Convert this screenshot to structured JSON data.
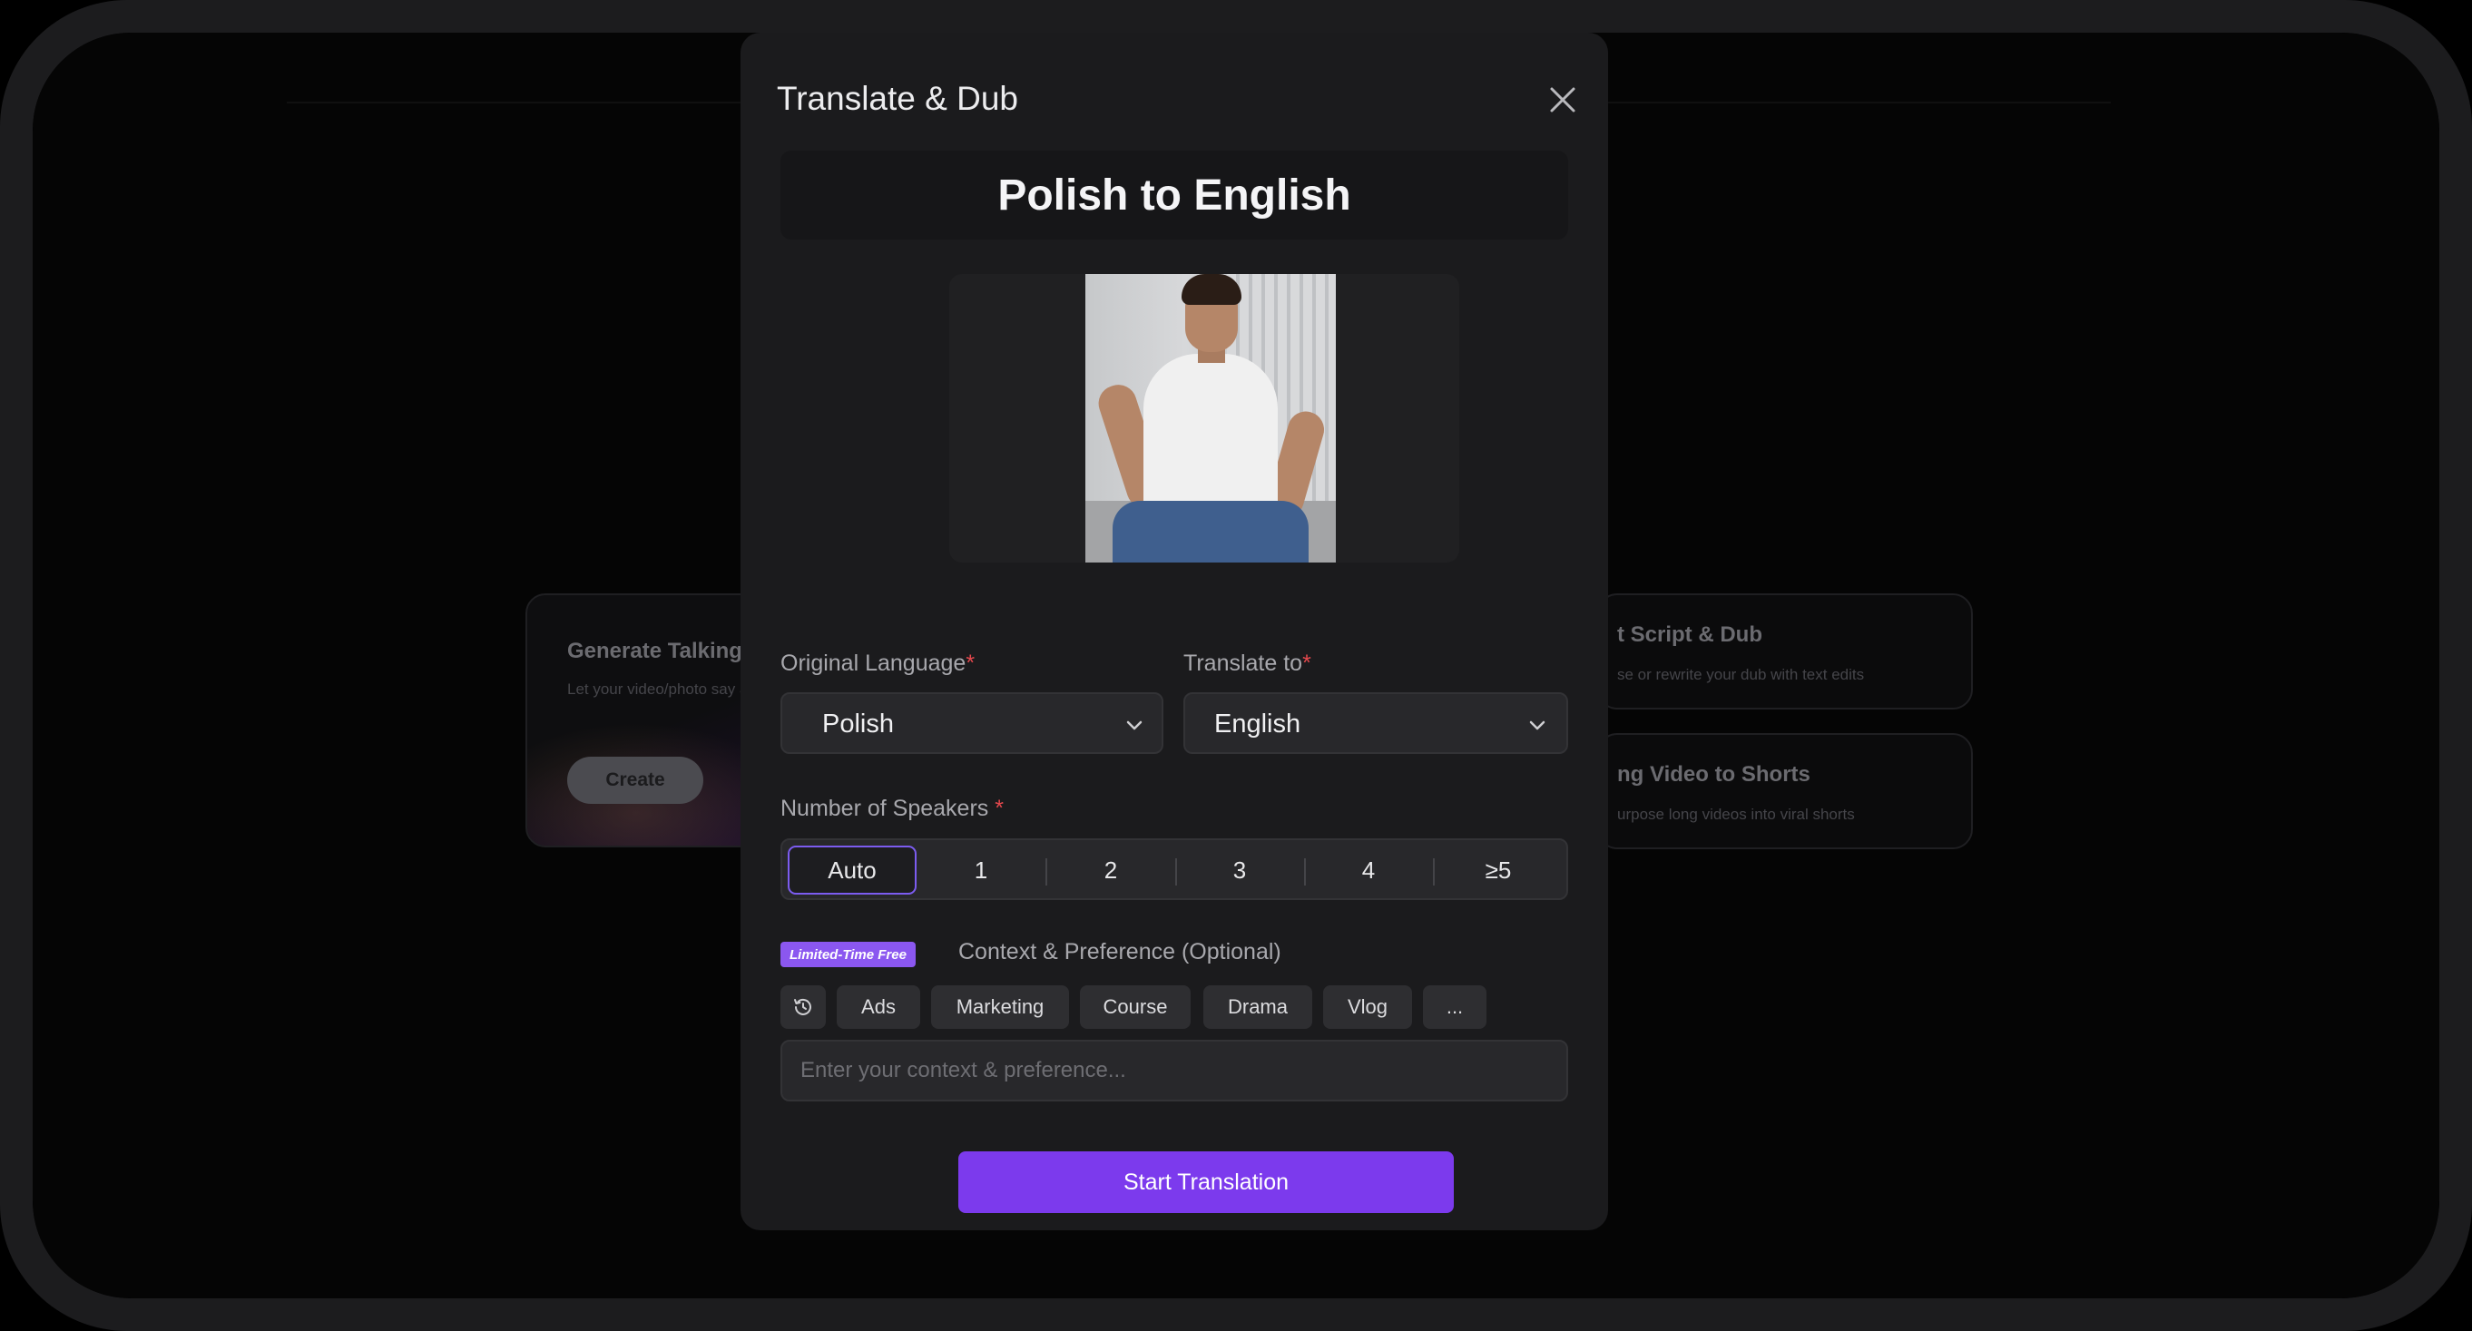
{
  "background": {
    "card_left": {
      "title": "Generate Talking Vi",
      "subtitle": "Let your video/photo say an",
      "button_label": "Create"
    },
    "card_right_1": {
      "title": "t Script & Dub",
      "subtitle": "se or rewrite your dub with text edits"
    },
    "card_right_2": {
      "title": "ng Video to Shorts",
      "subtitle": "urpose long videos into viral shorts"
    }
  },
  "modal": {
    "title": "Translate & Dub",
    "close_icon": "close-icon",
    "header_text": "Polish to English",
    "preview_image": "portrait of a man in a white t-shirt and jeans sitting on a couch",
    "original_language": {
      "label": "Original Language",
      "required_mark": "*",
      "value": "Polish"
    },
    "translate_to": {
      "label": "Translate to",
      "required_mark": "*",
      "value": "English"
    },
    "speakers": {
      "label": "Number of Speakers",
      "required_mark": "*",
      "options": [
        "Auto",
        "1",
        "2",
        "3",
        "4",
        "≥5"
      ],
      "selected": "Auto"
    },
    "context": {
      "badge": "Limited-Time Free",
      "label": "Context & Preference (Optional)",
      "history_icon": "history-icon",
      "chips": [
        "Ads",
        "Marketing",
        "Course",
        "Drama",
        "Vlog",
        "..."
      ],
      "placeholder": "Enter your context & preference..."
    },
    "start_button": "Start Translation",
    "colors": {
      "accent": "#7c3aed",
      "badge": "#8b57f0",
      "required": "#e5484d"
    }
  }
}
